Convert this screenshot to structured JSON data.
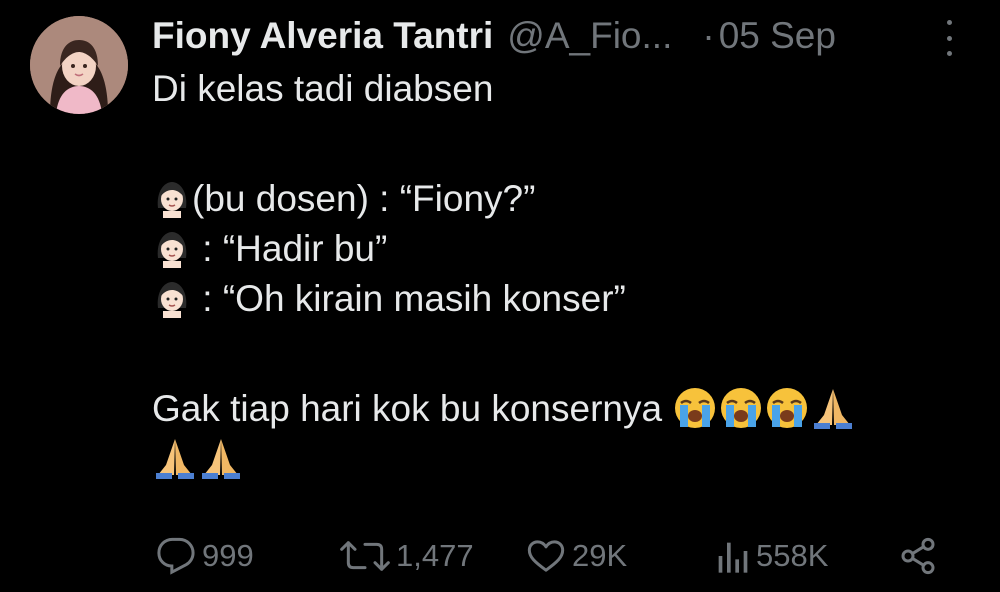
{
  "tweet": {
    "author_name": "Fiony Alveria Tantri",
    "handle": "@A_Fio...",
    "separator": "·",
    "date": "05 Sep",
    "lines": [
      "Di kelas tadi diabsen",
      "(bu dosen) : “Fiony?”",
      " : “Hadir bu”",
      " : “Oh kirain masih konser”",
      "Gak tiap hari kok bu konsernya"
    ]
  },
  "actions": {
    "replies": "999",
    "reposts": "1,477",
    "likes": "29K",
    "views": "558K"
  },
  "icons": {
    "more": "more-dots-icon",
    "reply": "reply-icon",
    "repost": "repost-icon",
    "like": "heart-icon",
    "views": "views-bar-chart-icon",
    "share": "share-icon",
    "woman_emoji": "woman-emoji-icon",
    "crying_emoji": "loudly-crying-face-emoji-icon",
    "pray_emoji": "folded-hands-emoji-icon"
  },
  "colors": {
    "background": "#000000",
    "text_primary": "#e7e9ea",
    "text_secondary": "#71767b"
  }
}
